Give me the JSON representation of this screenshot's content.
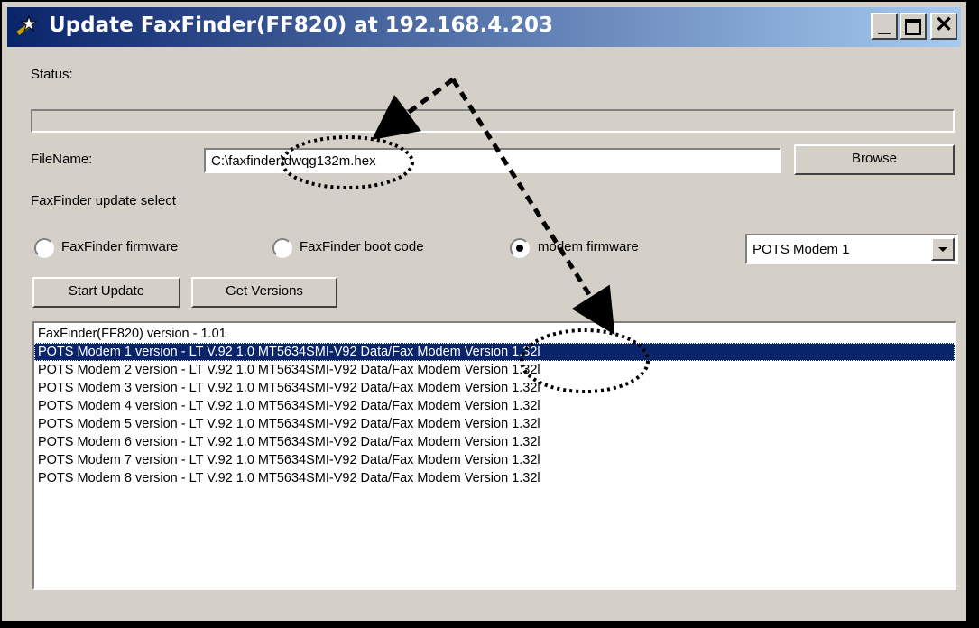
{
  "window": {
    "title": "Update FaxFinder(FF820) at 192.168.4.203"
  },
  "status": {
    "label": "Status:",
    "progress": 0
  },
  "filename": {
    "label": "FileName:",
    "value": "C:\\faxfinder\\dwqg132m.hex"
  },
  "buttons": {
    "browse": "Browse",
    "start_update": "Start Update",
    "get_versions": "Get Versions"
  },
  "update_select": {
    "label": "FaxFinder update select",
    "options": [
      "FaxFinder firmware",
      "FaxFinder boot code",
      "modem firmware"
    ],
    "selected": "modem firmware"
  },
  "modem_select": {
    "value": "POTS Modem 1"
  },
  "versions": [
    "FaxFinder(FF820) version - 1.01",
    "POTS Modem 1 version - LT V.92 1.0 MT5634SMI-V92 Data/Fax Modem Version 1.32l",
    "POTS Modem 2 version - LT V.92 1.0 MT5634SMI-V92 Data/Fax Modem Version 1.32l",
    "POTS Modem 3 version - LT V.92 1.0 MT5634SMI-V92 Data/Fax Modem Version 1.32l",
    "POTS Modem 4 version - LT V.92 1.0 MT5634SMI-V92 Data/Fax Modem Version 1.32l",
    "POTS Modem 5 version - LT V.92 1.0 MT5634SMI-V92 Data/Fax Modem Version 1.32l",
    "POTS Modem 6 version - LT V.92 1.0 MT5634SMI-V92 Data/Fax Modem Version 1.32l",
    "POTS Modem 7 version - LT V.92 1.0 MT5634SMI-V92 Data/Fax Modem Version 1.32l",
    "POTS Modem 8 version - LT V.92 1.0 MT5634SMI-V92 Data/Fax Modem Version 1.32l"
  ],
  "selected_version_index": 1,
  "colors": {
    "title_start": "#0a246a",
    "title_end": "#a6caf0",
    "face": "#d4d0c8",
    "selection": "#0a246a"
  },
  "icons": {
    "app": "wand-icon",
    "minimize": "minimize-icon",
    "maximize": "maximize-icon",
    "close": "close-icon"
  }
}
